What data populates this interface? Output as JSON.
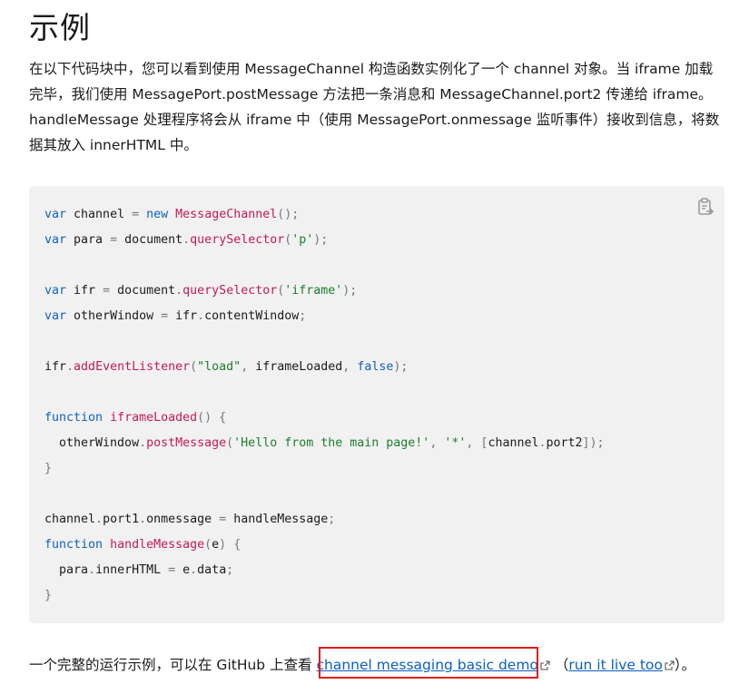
{
  "heading": "示例",
  "intro": "在以下代码块中，您可以看到使用 MessageChannel 构造函数实例化了一个 channel 对象。当 iframe 加载完毕，我们使用 MessagePort.postMessage 方法把一条消息和 MessageChannel.port2 传递给 iframe。handleMessage 处理程序将会从 iframe 中（使用 MessagePort.onmessage 监听事件）接收到信息，将数据其放入 innerHTML 中。",
  "code": {
    "copy_icon": "clipboard-icon",
    "lines": [
      [
        [
          "kw",
          "var"
        ],
        [
          "t",
          " channel "
        ],
        [
          "pn",
          "="
        ],
        [
          "t",
          " "
        ],
        [
          "kw",
          "new"
        ],
        [
          "t",
          " "
        ],
        [
          "fn",
          "MessageChannel"
        ],
        [
          "pn",
          "();"
        ]
      ],
      [
        [
          "kw",
          "var"
        ],
        [
          "t",
          " para "
        ],
        [
          "pn",
          "="
        ],
        [
          "t",
          " document"
        ],
        [
          "pn",
          "."
        ],
        [
          "fn",
          "querySelector"
        ],
        [
          "pn",
          "("
        ],
        [
          "st",
          "'p'"
        ],
        [
          "pn",
          ");"
        ]
      ],
      [],
      [
        [
          "kw",
          "var"
        ],
        [
          "t",
          " ifr "
        ],
        [
          "pn",
          "="
        ],
        [
          "t",
          " document"
        ],
        [
          "pn",
          "."
        ],
        [
          "fn",
          "querySelector"
        ],
        [
          "pn",
          "("
        ],
        [
          "st",
          "'iframe'"
        ],
        [
          "pn",
          ");"
        ]
      ],
      [
        [
          "kw",
          "var"
        ],
        [
          "t",
          " otherWindow "
        ],
        [
          "pn",
          "="
        ],
        [
          "t",
          " ifr"
        ],
        [
          "pn",
          "."
        ],
        [
          "t",
          "contentWindow"
        ],
        [
          "pn",
          ";"
        ]
      ],
      [],
      [
        [
          "t",
          "ifr"
        ],
        [
          "pn",
          "."
        ],
        [
          "fn",
          "addEventListener"
        ],
        [
          "pn",
          "("
        ],
        [
          "st",
          "\"load\""
        ],
        [
          "pn",
          ","
        ],
        [
          "t",
          " iframeLoaded"
        ],
        [
          "pn",
          ","
        ],
        [
          "t",
          " "
        ],
        [
          "kw",
          "false"
        ],
        [
          "pn",
          ");"
        ]
      ],
      [],
      [
        [
          "kw",
          "function"
        ],
        [
          "t",
          " "
        ],
        [
          "fn",
          "iframeLoaded"
        ],
        [
          "pn",
          "()"
        ],
        [
          "t",
          " "
        ],
        [
          "pn",
          "{"
        ]
      ],
      [
        [
          "t",
          "  otherWindow"
        ],
        [
          "pn",
          "."
        ],
        [
          "fn",
          "postMessage"
        ],
        [
          "pn",
          "("
        ],
        [
          "st",
          "'Hello from the main page!'"
        ],
        [
          "pn",
          ","
        ],
        [
          "t",
          " "
        ],
        [
          "st",
          "'*'"
        ],
        [
          "pn",
          ","
        ],
        [
          "t",
          " "
        ],
        [
          "pn",
          "["
        ],
        [
          "t",
          "channel"
        ],
        [
          "pn",
          "."
        ],
        [
          "t",
          "port2"
        ],
        [
          "pn",
          "]);"
        ]
      ],
      [
        [
          "pn",
          "}"
        ]
      ],
      [],
      [
        [
          "t",
          "channel"
        ],
        [
          "pn",
          "."
        ],
        [
          "t",
          "port1"
        ],
        [
          "pn",
          "."
        ],
        [
          "t",
          "onmessage "
        ],
        [
          "pn",
          "="
        ],
        [
          "t",
          " handleMessage"
        ],
        [
          "pn",
          ";"
        ]
      ],
      [
        [
          "kw",
          "function"
        ],
        [
          "t",
          " "
        ],
        [
          "fn",
          "handleMessage"
        ],
        [
          "pn",
          "("
        ],
        [
          "t",
          "e"
        ],
        [
          "pn",
          ")"
        ],
        [
          "t",
          " "
        ],
        [
          "pn",
          "{"
        ]
      ],
      [
        [
          "t",
          "  para"
        ],
        [
          "pn",
          "."
        ],
        [
          "t",
          "innerHTML "
        ],
        [
          "pn",
          "="
        ],
        [
          "t",
          " e"
        ],
        [
          "pn",
          "."
        ],
        [
          "t",
          "data"
        ],
        [
          "pn",
          ";"
        ]
      ],
      [
        [
          "pn",
          "}"
        ]
      ]
    ]
  },
  "footer": {
    "prefix": "一个完整的运行示例，可以在 GitHub 上查看 ",
    "demo_link": "channel messaging basic demo",
    "middle": " （",
    "live_link": "run it live too",
    "suffix": "）。",
    "external_icon": "external-link-icon"
  },
  "colors": {
    "keyword": "#0c62c4",
    "function": "#c41a57",
    "string": "#1a7f2e",
    "link": "#0b5ec1",
    "highlight": "#e31b1b",
    "code_bg": "#f2f1f1"
  }
}
